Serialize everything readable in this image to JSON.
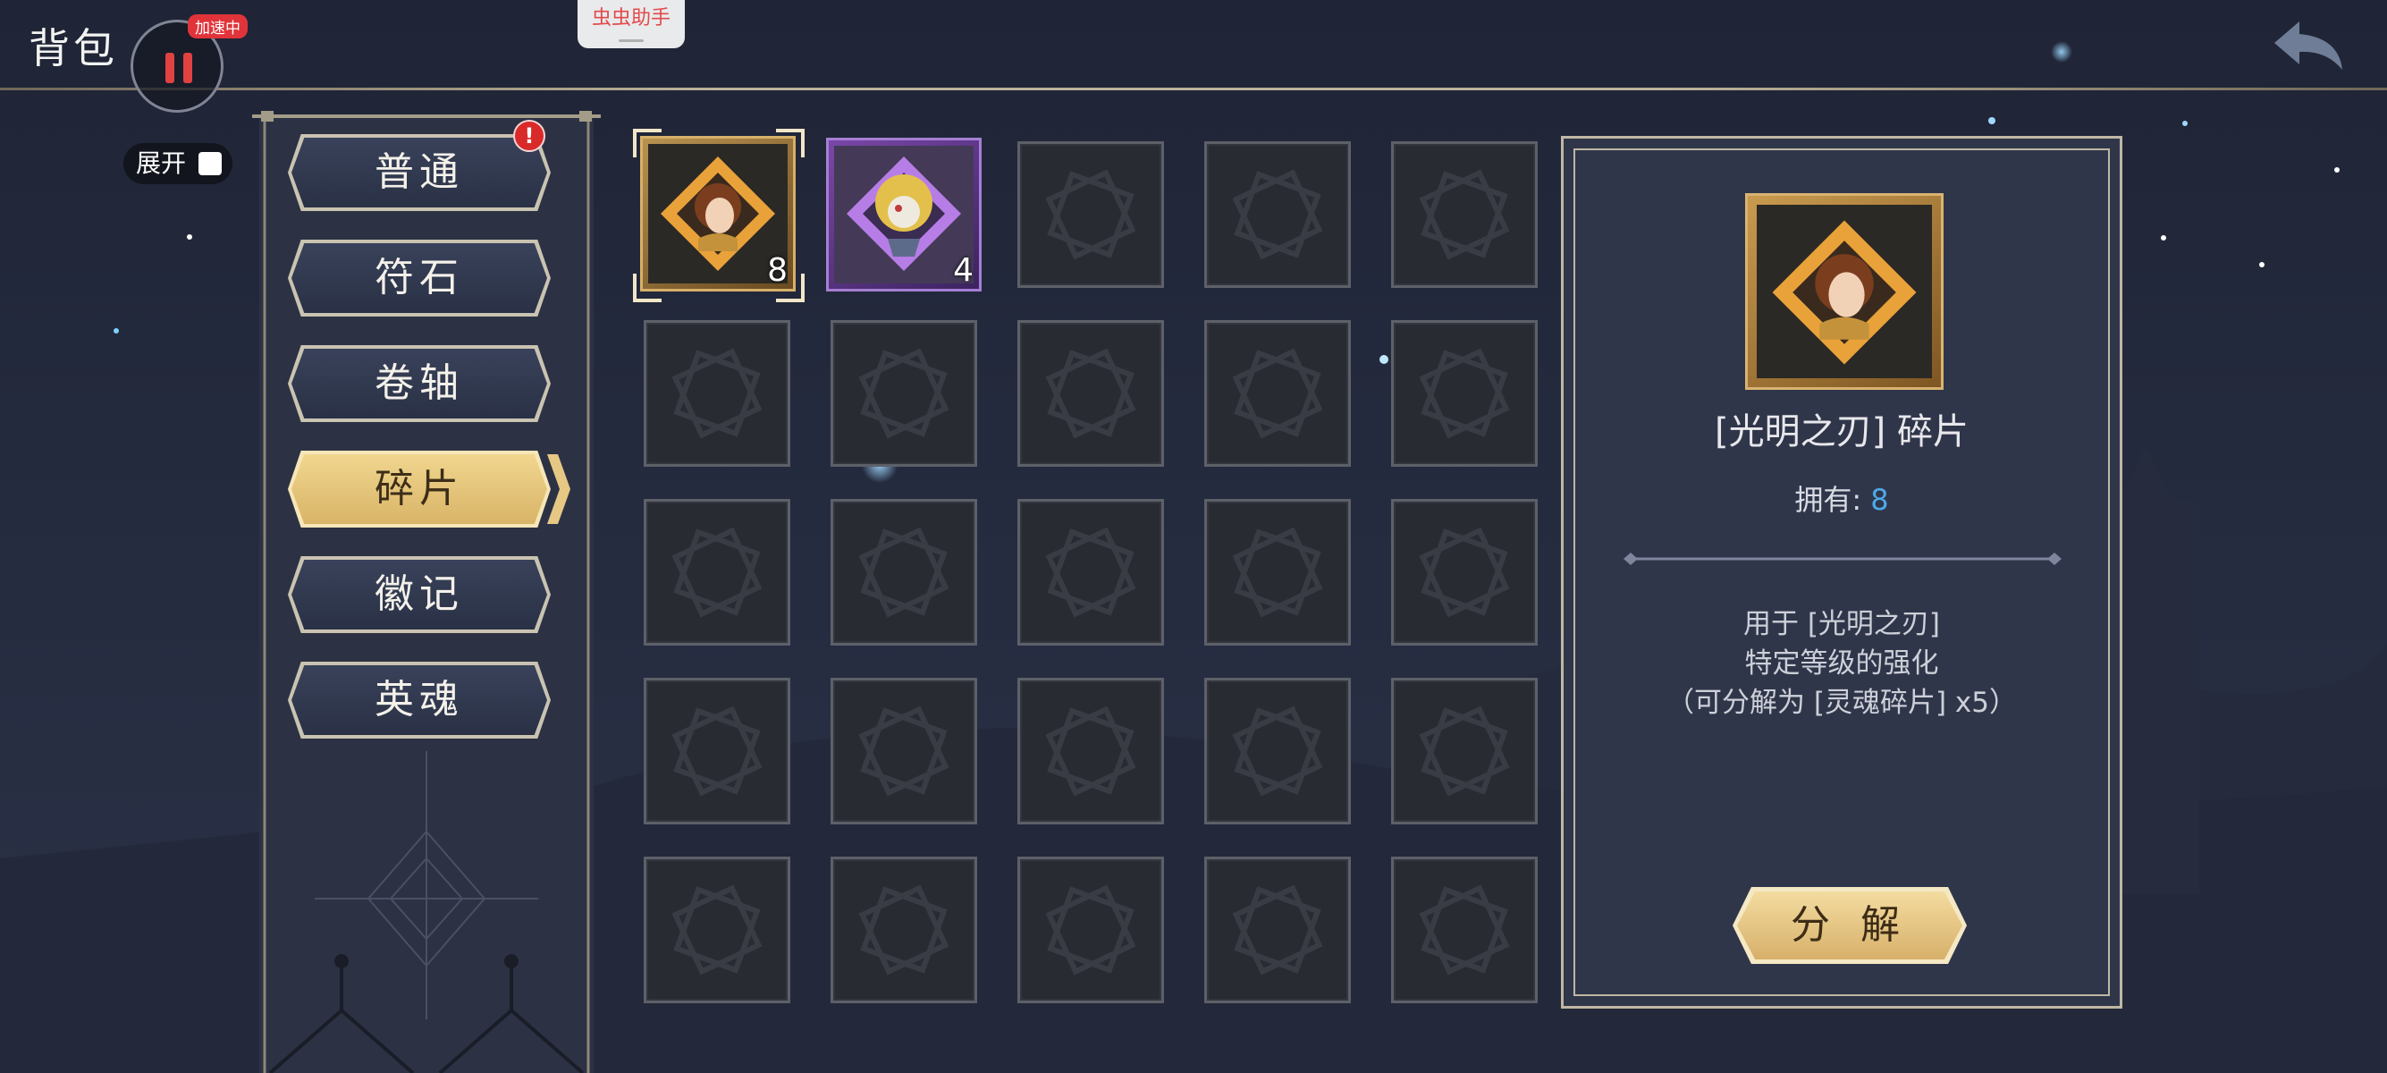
{
  "topbar": {
    "title": "背包",
    "speed_badge": "加速中",
    "helper_tab": "虫虫助手"
  },
  "expand": {
    "label": "展开"
  },
  "categories": {
    "items": [
      {
        "label": "普通",
        "active": false,
        "alert": true
      },
      {
        "label": "符石",
        "active": false,
        "alert": false
      },
      {
        "label": "卷轴",
        "active": false,
        "alert": false
      },
      {
        "label": "碎片",
        "active": true,
        "alert": false
      },
      {
        "label": "徽记",
        "active": false,
        "alert": false
      },
      {
        "label": "英魂",
        "active": false,
        "alert": false
      }
    ],
    "alert_mark": "!"
  },
  "inventory": {
    "rows": 5,
    "columns": 5,
    "items": [
      {
        "rarity": "gold",
        "count": "8",
        "selected": true,
        "icon": "blade-of-light-fragment-icon"
      },
      {
        "rarity": "purple",
        "count": "4",
        "selected": false,
        "icon": "golden-mask-fragment-icon"
      }
    ]
  },
  "detail": {
    "name": "[光明之刃] 碎片",
    "owned_label": "拥有:",
    "owned_value": "8",
    "description": [
      "用于 [光明之刃]",
      "特定等级的强化",
      "（可分解为 [灵魂碎片] x5）"
    ],
    "action_label": "分 解"
  },
  "colors": {
    "accent_gold": "#d8b467",
    "owned_blue": "#4ea9e8",
    "alert_red": "#d92a2a",
    "purple_rarity": "#7a47a8"
  }
}
